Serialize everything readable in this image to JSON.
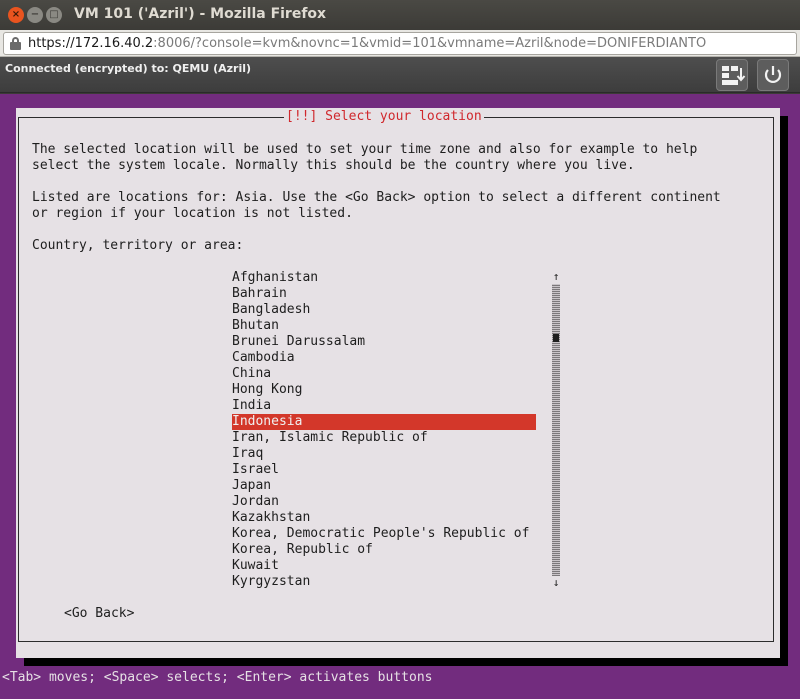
{
  "window": {
    "title": "VM 101 ('Azril') - Mozilla Firefox",
    "close_glyph": "×",
    "minimize_glyph": "−",
    "maximize_glyph": "□"
  },
  "browser": {
    "url_host": "https://172.16.40.2",
    "url_rest": ":8006/?console=kvm&novnc=1&vmid=101&vmname=Azril&node=DONIFERDIANTO"
  },
  "vnc": {
    "status": "Connected (encrypted) to: QEMU (Azril)"
  },
  "dialog": {
    "title": "[!!] Select your location",
    "paragraph1_line1": "The selected location will be used to set your time zone and also for example to help",
    "paragraph1_line2": "select the system locale. Normally this should be the country where you live.",
    "paragraph2_line1": "Listed are locations for: Asia. Use the <Go Back> option to select a different continent",
    "paragraph2_line2": "or region if your location is not listed.",
    "prompt": "Country, territory or area:",
    "countries": [
      "Afghanistan",
      "Bahrain",
      "Bangladesh",
      "Bhutan",
      "Brunei Darussalam",
      "Cambodia",
      "China",
      "Hong Kong",
      "India",
      "Indonesia",
      "Iran, Islamic Republic of",
      "Iraq",
      "Israel",
      "Japan",
      "Jordan",
      "Kazakhstan",
      "Korea, Democratic People's Republic of",
      "Korea, Republic of",
      "Kuwait",
      "Kyrgyzstan"
    ],
    "selected_index": 9,
    "scroll_up_glyph": "↑",
    "scroll_down_glyph": "↓",
    "go_back": "<Go Back>"
  },
  "footer_hint": "<Tab> moves; <Space> selects; <Enter> activates buttons",
  "colors": {
    "console_bg": "#722c7e",
    "dialog_bg": "#e6e1e5",
    "selection": "#d3372a",
    "title_red": "#d0282d"
  }
}
